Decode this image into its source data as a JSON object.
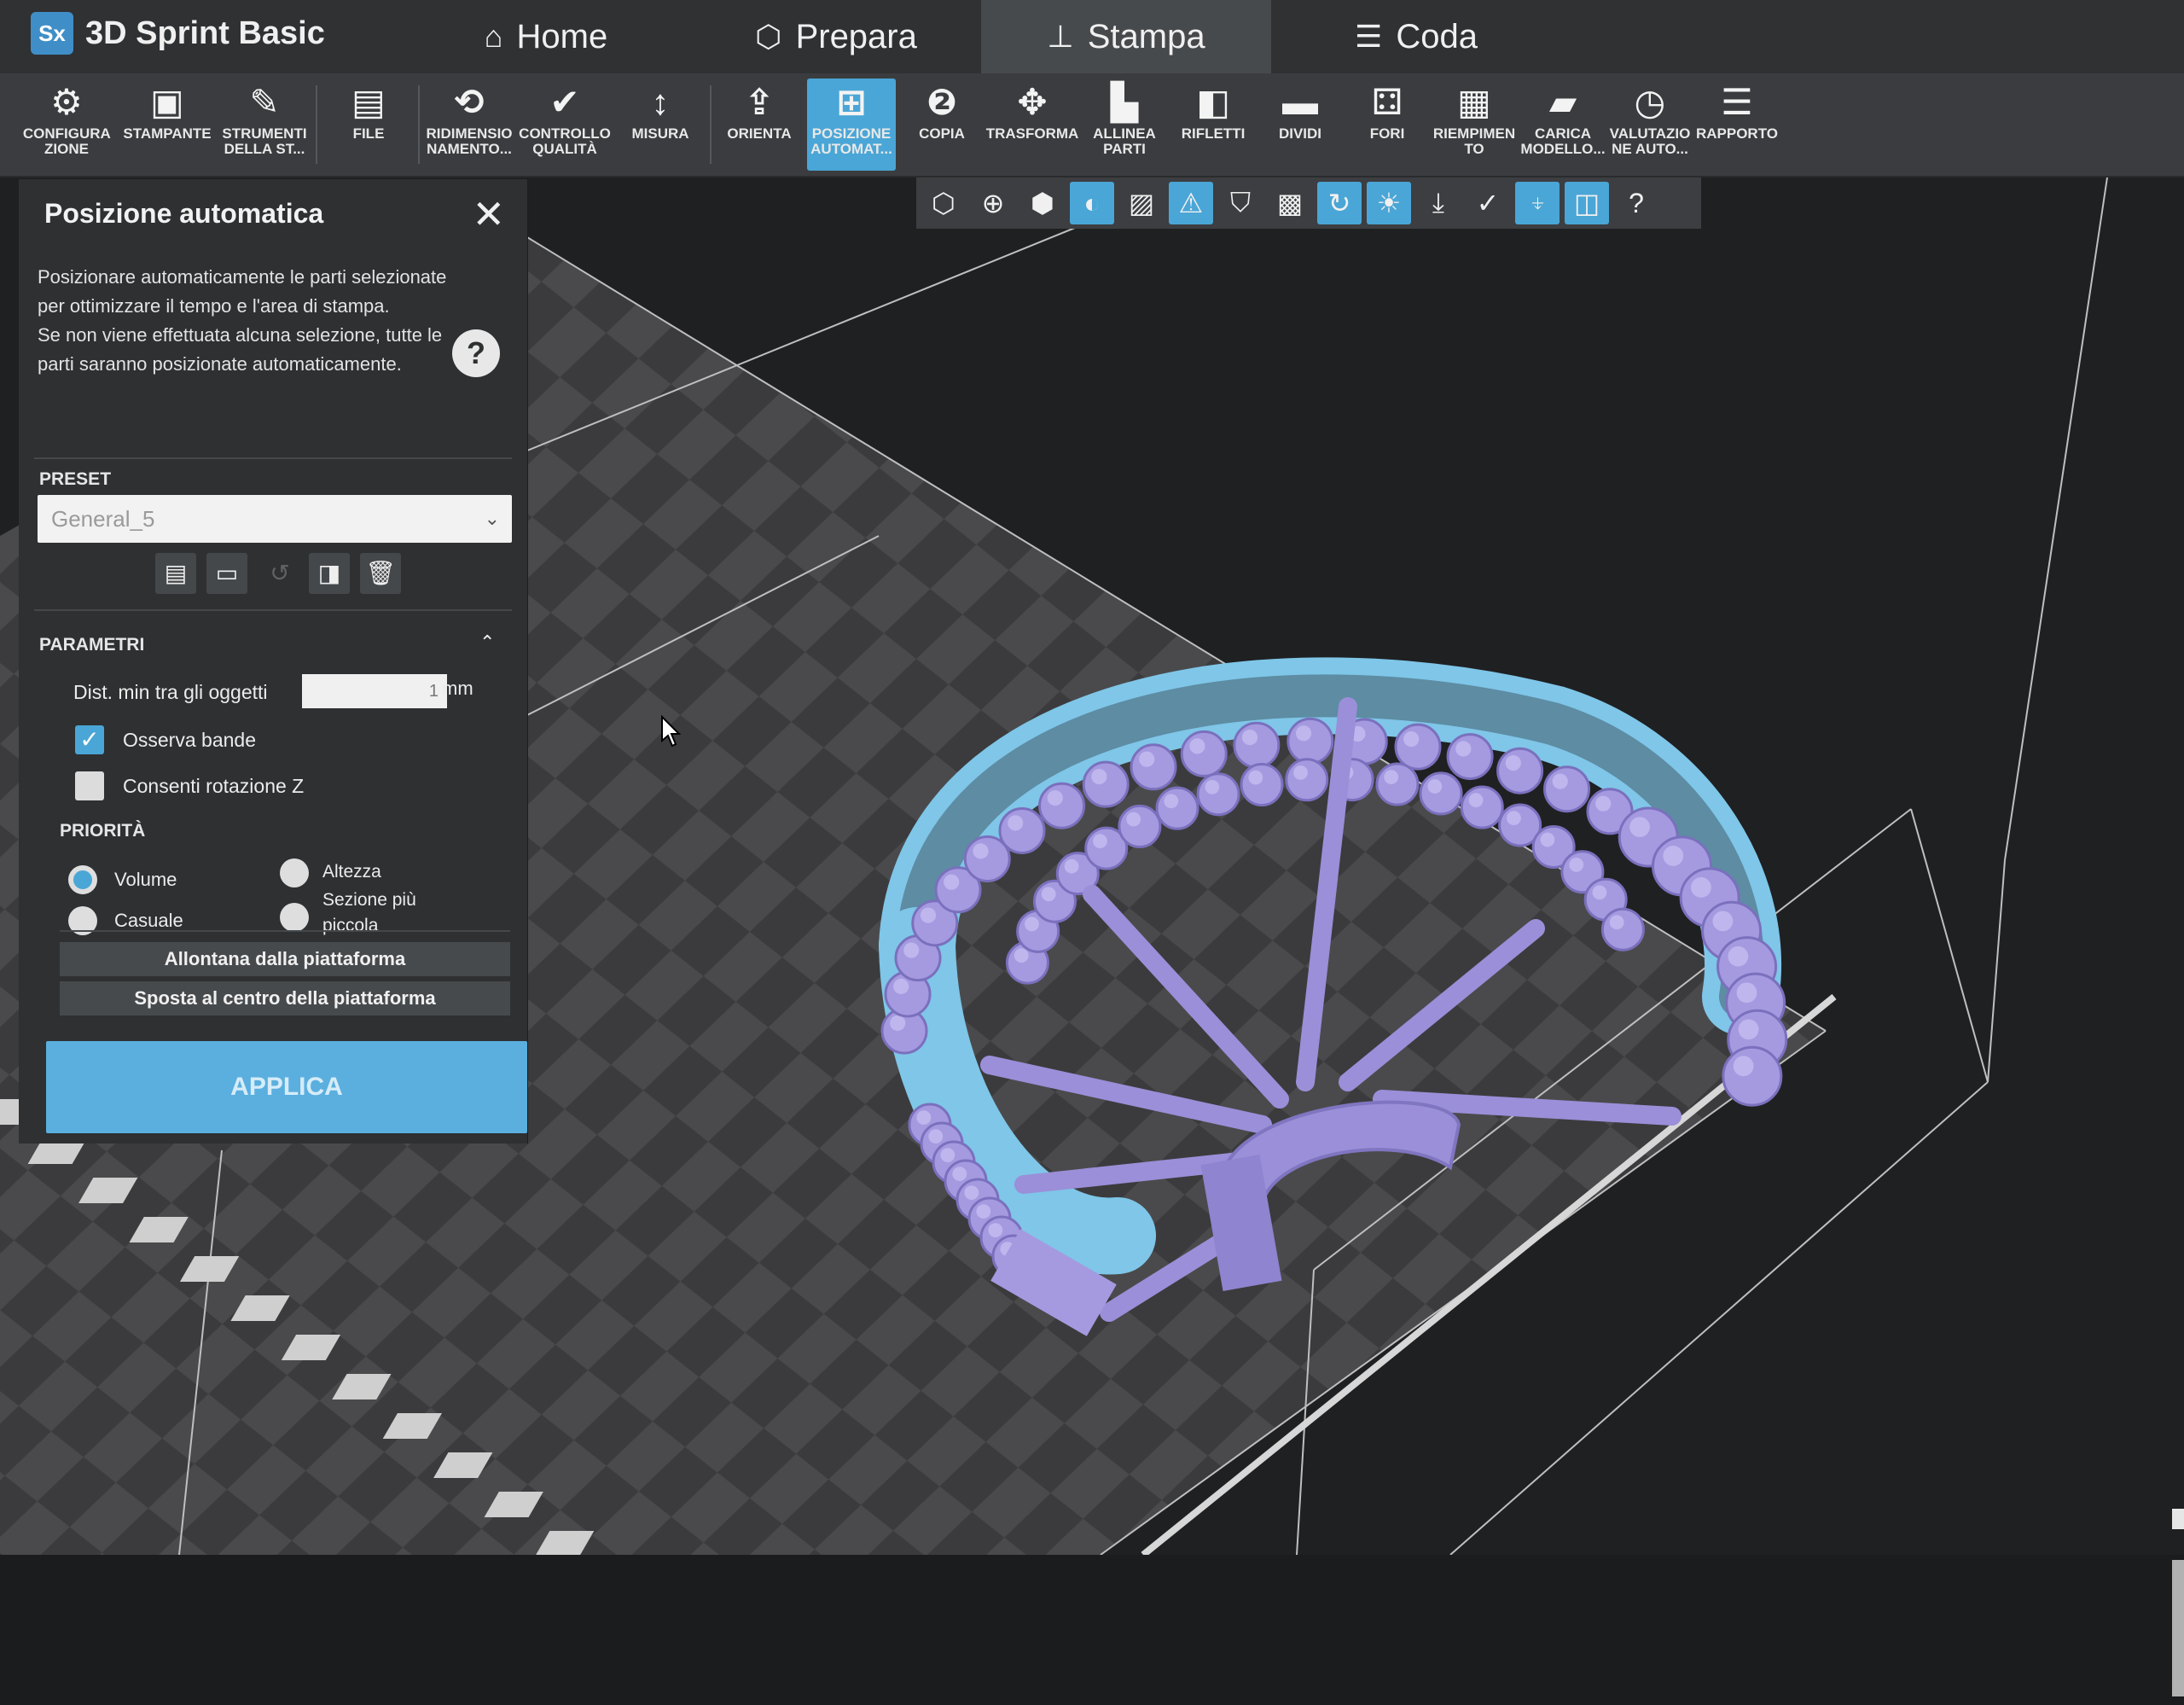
{
  "app": {
    "name": "3D Sprint Basic",
    "logo_text": "Sx"
  },
  "tabs": [
    {
      "label": "Home",
      "icon": "home-icon"
    },
    {
      "label": "Prepara",
      "icon": "cube-icon"
    },
    {
      "label": "Stampa",
      "icon": "printer-icon",
      "active": true
    },
    {
      "label": "Coda",
      "icon": "queue-list-icon"
    }
  ],
  "ribbon": {
    "configurazione": "CONFIGURA ZIONE",
    "stampante": "STAMPANTE",
    "strumenti": "STRUMENTI DELLA ST...",
    "file": "FILE",
    "ridimensionamento": "RIDIMENSIO NAMENTO...",
    "controllo": "CONTROLLO QUALITÀ",
    "misura": "MISURA",
    "orienta": "ORIENTA",
    "posizione": "POSIZIONE AUTOMAT...",
    "copia": "COPIA",
    "trasforma": "TRASFORMA",
    "allinea": "ALLINEA PARTI",
    "rifletti": "RIFLETTI",
    "dividi": "DIVIDI",
    "fori": "FORI",
    "riempimento": "RIEMPIMEN TO",
    "carica": "CARICA MODELLO...",
    "valutazione": "VALUTAZIO NE AUTO...",
    "rapporto": "RAPPORTO"
  },
  "panel": {
    "title": "Posizione automatica",
    "description_1": "Posizionare automaticamente le parti selezionate per ottimizzare il tempo e l'area di stampa.",
    "description_2": "Se non viene effettuata alcuna selezione, tutte le parti saranno posizionate automaticamente.",
    "help": "?",
    "preset_label": "PRESET",
    "preset_value": "General_5",
    "parametri_label": "PARAMETRI",
    "dist_label": "Dist. min tra gli oggetti",
    "dist_value": "1",
    "dist_unit": "mm",
    "osserva_bande": "Osserva bande",
    "osserva_bande_checked": true,
    "rotazione_z": "Consenti rotazione Z",
    "rotazione_z_checked": false,
    "priorita_label": "PRIORITÀ",
    "priority_options": [
      "Volume",
      "Altezza",
      "Casuale",
      "Sezione più piccola"
    ],
    "priority_selected": "Volume",
    "allontana": "Allontana dalla piattaforma",
    "sposta": "Sposta al centro della piattaforma",
    "applica": "APPLICA"
  },
  "colors": {
    "accent": "#4aa6d6",
    "model": "#a59ae0",
    "model_outline": "#7fc6e8",
    "panel_bg": "#2e3032"
  }
}
